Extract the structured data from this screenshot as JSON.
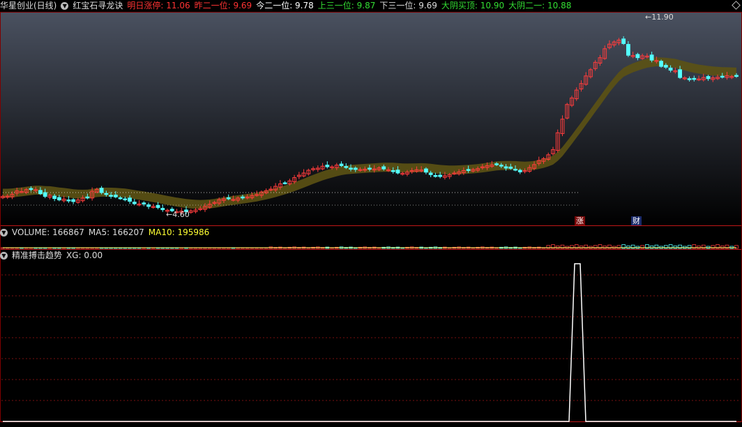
{
  "header": {
    "stock_name": "华星创业(日线)",
    "indicator_name": "红宝石寻龙诀",
    "items": [
      {
        "label": "明日涨停",
        "value": "11.06",
        "color": "#ff3333"
      },
      {
        "label": "昨二一位",
        "value": "9.69",
        "color": "#ff3333"
      },
      {
        "label": "今二一位",
        "value": "9.78",
        "color": "#ffffff"
      },
      {
        "label": "上三一位",
        "value": "9.87",
        "color": "#33dd33"
      },
      {
        "label": "下三一位",
        "value": "9.69",
        "color": "#dddddd"
      },
      {
        "label": "大阴买顶",
        "value": "10.90",
        "color": "#33dd33"
      },
      {
        "label": "大阴二一",
        "value": "10.88",
        "color": "#33dd33"
      }
    ]
  },
  "price_panel": {
    "high_label": "11.90",
    "low_label": "4.60",
    "badge_zhang": "涨",
    "badge_cai": "财"
  },
  "volume_panel": {
    "volume_label": "VOLUME: 166867",
    "ma5_label": "MA5: 166207",
    "ma10_label": "MA10: 195986"
  },
  "indicator_panel": {
    "name": "精准搏击趋势",
    "xg_label": "XG: 0.00"
  },
  "chart_data": {
    "type": "candlestick",
    "price_range": [
      4.3,
      12.1
    ],
    "candle_count": 157,
    "closes": [
      5.34,
      5.35,
      5.42,
      5.54,
      5.52,
      5.59,
      5.6,
      5.59,
      5.44,
      5.34,
      5.38,
      5.26,
      5.21,
      5.24,
      5.18,
      5.15,
      5.21,
      5.28,
      5.31,
      5.53,
      5.6,
      5.48,
      5.41,
      5.35,
      5.32,
      5.28,
      5.24,
      5.16,
      5.07,
      5.06,
      5.06,
      4.97,
      4.97,
      4.93,
      4.85,
      4.83,
      4.81,
      4.78,
      4.8,
      4.78,
      4.81,
      4.84,
      4.89,
      4.97,
      5.05,
      5.12,
      5.22,
      5.25,
      5.25,
      5.23,
      5.28,
      5.31,
      5.32,
      5.37,
      5.41,
      5.5,
      5.55,
      5.61,
      5.71,
      5.8,
      5.83,
      5.91,
      6.03,
      6.12,
      6.2,
      6.3,
      6.36,
      6.38,
      6.45,
      6.43,
      6.43,
      6.49,
      6.47,
      6.41,
      6.34,
      6.33,
      6.33,
      6.34,
      6.34,
      6.35,
      6.39,
      6.35,
      6.32,
      6.27,
      6.2,
      6.19,
      6.23,
      6.29,
      6.32,
      6.31,
      6.23,
      6.14,
      6.08,
      6.07,
      6.1,
      6.14,
      6.2,
      6.24,
      6.29,
      6.3,
      6.33,
      6.36,
      6.43,
      6.47,
      6.5,
      6.52,
      6.46,
      6.38,
      6.37,
      6.33,
      6.24,
      6.29,
      6.4,
      6.51,
      6.66,
      6.73,
      6.87,
      7.06,
      7.68,
      8.18,
      8.72,
      8.96,
      9.25,
      9.49,
      9.77,
      10.0,
      10.27,
      10.44,
      10.77,
      10.94,
      11.02,
      11.09,
      10.96,
      10.53,
      10.52,
      10.44,
      10.51,
      10.5,
      10.35,
      10.34,
      10.12,
      10.09,
      9.98,
      9.96,
      9.71,
      9.7,
      9.64,
      9.66,
      9.66,
      9.71,
      9.67,
      9.7,
      9.72,
      9.74,
      9.78,
      9.75,
      9.75
    ]
  }
}
